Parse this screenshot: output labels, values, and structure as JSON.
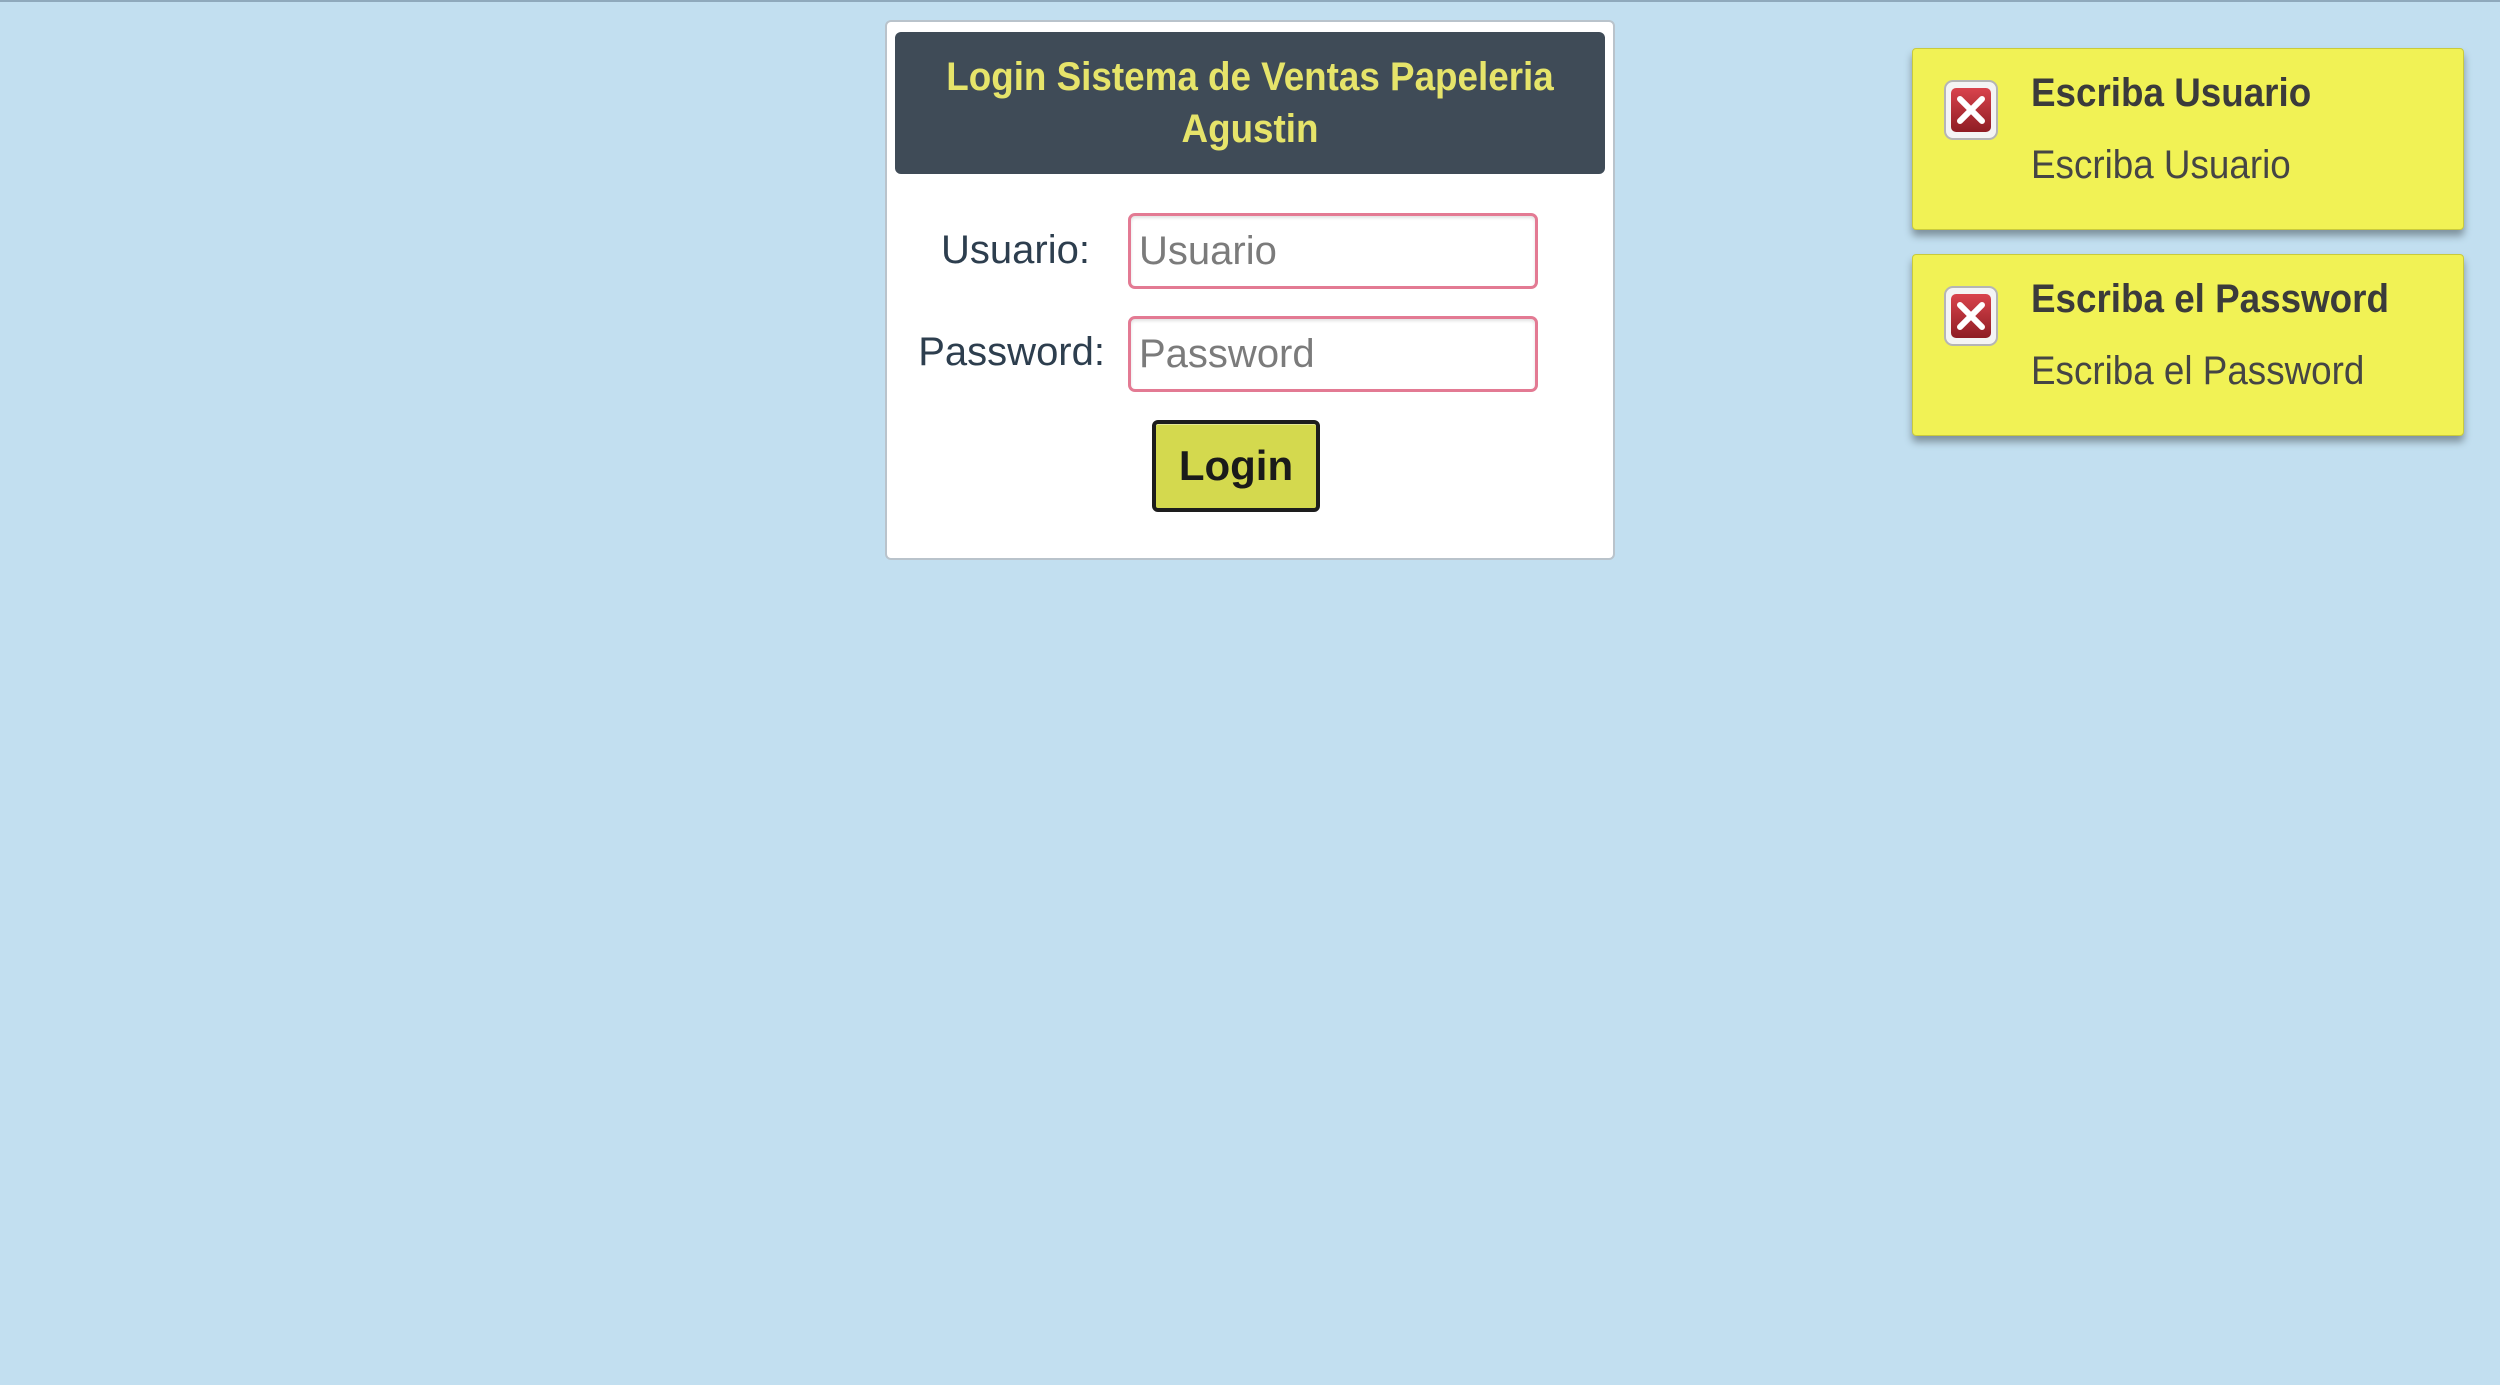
{
  "login": {
    "title": "Login Sistema de Ventas Papeleria Agustin",
    "username_label": "Usuario:",
    "username_placeholder": "Usuario",
    "username_value": "",
    "password_label": "Password:",
    "password_placeholder": "Password",
    "password_value": "",
    "submit_label": "Login"
  },
  "notifications": [
    {
      "title": "Escriba Usuario",
      "message": "Escriba Usuario",
      "icon": "error-close-icon"
    },
    {
      "title": "Escriba el Password",
      "message": "Escriba el Password",
      "icon": "error-close-icon"
    }
  ],
  "colors": {
    "page_background": "#c2dff0",
    "header_background": "#3f4b57",
    "header_text": "#e6e46a",
    "button_background": "#d4d94e",
    "input_error_border": "#e37a93",
    "notification_background": "#f1f255"
  }
}
